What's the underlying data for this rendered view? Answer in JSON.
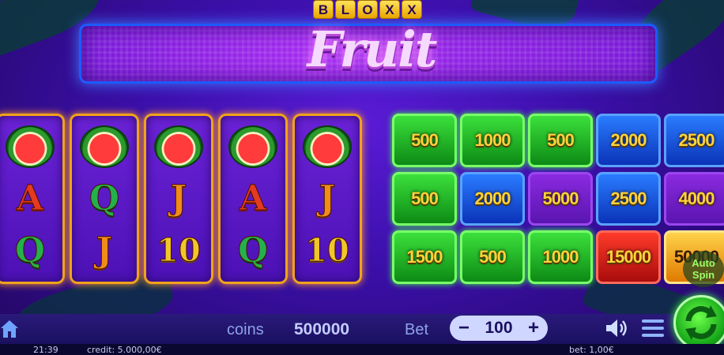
{
  "logo": {
    "top_letters": [
      "B",
      "L",
      "O",
      "X",
      "X"
    ],
    "title": "Fruit"
  },
  "reels": [
    [
      "watermelon",
      "A",
      "Q"
    ],
    [
      "watermelon",
      "Q",
      "J"
    ],
    [
      "watermelon",
      "J",
      "10"
    ],
    [
      "watermelon",
      "A",
      "Q"
    ],
    [
      "watermelon",
      "J",
      "10"
    ]
  ],
  "reel_symbol_colors": {
    "A": "red",
    "Q": "green",
    "J": "orange",
    "10": "gold"
  },
  "bonus_grid": [
    [
      {
        "value": "500",
        "color": "green"
      },
      {
        "value": "1000",
        "color": "green"
      },
      {
        "value": "500",
        "color": "green"
      },
      {
        "value": "2000",
        "color": "blue"
      },
      {
        "value": "2500",
        "color": "blue"
      }
    ],
    [
      {
        "value": "500",
        "color": "green"
      },
      {
        "value": "2000",
        "color": "blue"
      },
      {
        "value": "5000",
        "color": "purple"
      },
      {
        "value": "2500",
        "color": "blue"
      },
      {
        "value": "4000",
        "color": "purple"
      }
    ],
    [
      {
        "value": "1500",
        "color": "green"
      },
      {
        "value": "500",
        "color": "green"
      },
      {
        "value": "1000",
        "color": "green"
      },
      {
        "value": "15000",
        "color": "red"
      },
      {
        "value": "50000",
        "color": "gold"
      }
    ]
  ],
  "autospin": {
    "label_line1": "Auto",
    "label_line2": "Spin"
  },
  "bottom": {
    "coins_label": "coins",
    "coins_value": "500000",
    "bet_label": "Bet",
    "bet_value": "100",
    "minus": "−",
    "plus": "+"
  },
  "status": {
    "time": "21:39",
    "credit": "credit: 5.000,00€",
    "bet": "bet: 1,00€"
  },
  "icons": [
    "home-icon",
    "speaker-icon",
    "menu-icon",
    "spin-arrows-icon",
    "watermelon-icon"
  ]
}
